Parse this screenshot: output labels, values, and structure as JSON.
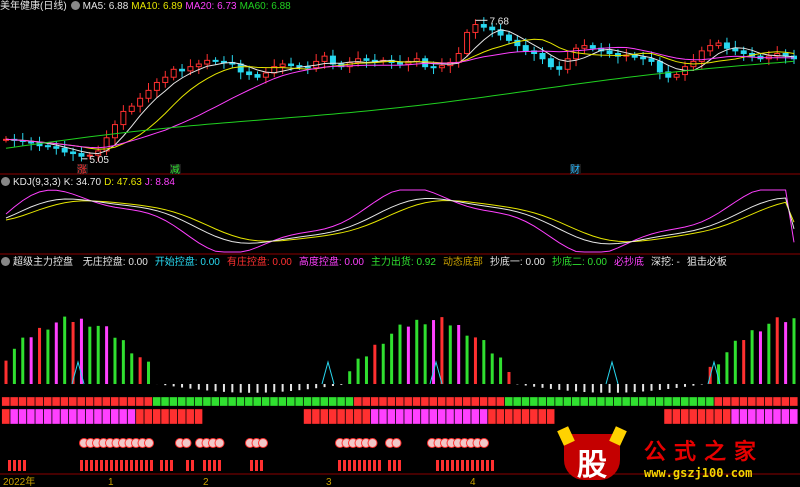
{
  "header_main": {
    "title": "美年健康(日线)",
    "ma5": "MA5: 6.88",
    "ma10": "MA10: 6.89",
    "ma20": "MA20: 6.73",
    "ma60": "MA60: 6.88"
  },
  "header_kdj": {
    "title": "KDJ(9,3,3)",
    "k": "K: 34.70",
    "d": "D: 47.63",
    "j": "J: 8.84"
  },
  "header_ind": {
    "title": "超级主力控盘",
    "items": [
      {
        "label": "无庄控盘: 0.00",
        "color": "#e6e6e6"
      },
      {
        "label": "开始控盘: 0.00",
        "color": "#28d8f0"
      },
      {
        "label": "有庄控盘: 0.00",
        "color": "#ff3030"
      },
      {
        "label": "高度控盘: 0.00",
        "color": "#ff40ff"
      },
      {
        "label": "主力出货: 0.92",
        "color": "#30e030"
      },
      {
        "label": "动态底部",
        "color": "#c8a000"
      },
      {
        "label": "抄底一: 0.00",
        "color": "#e6e6e6"
      },
      {
        "label": "抄底二: 0.00",
        "color": "#30e030"
      },
      {
        "label": "必抄底",
        "color": "#ff40ff"
      },
      {
        "label": "深挖: -",
        "color": "#e6e6e6"
      },
      {
        "label": "狙击必板",
        "color": "#e6e6e6"
      }
    ]
  },
  "annotations": {
    "high": "7.68",
    "low": "5.05",
    "markers": [
      {
        "text": "涨",
        "color": "#ff3030"
      },
      {
        "text": "减",
        "color": "#30e030"
      },
      {
        "text": "财",
        "color": "#28b8ff"
      }
    ]
  },
  "x_axis": {
    "labels": [
      "2022年",
      "1",
      "2",
      "3",
      "4"
    ]
  },
  "watermark": {
    "icon_text": "股",
    "name": "公式之家",
    "url": "www.gszj100.com"
  },
  "colors": {
    "up": "#ff3030",
    "down": "#28d8f0",
    "ma5": "#e6e6e6",
    "ma10": "#e6e600",
    "ma20": "#ff40ff",
    "ma60": "#20d020",
    "k": "#e6e6e6",
    "d": "#e6e600",
    "j": "#ff40ff"
  },
  "chart_data": [
    {
      "type": "candlestick",
      "title": "美年健康(日线)",
      "series": [
        {
          "name": "MA5",
          "value": 6.88
        },
        {
          "name": "MA10",
          "value": 6.89
        },
        {
          "name": "MA20",
          "value": 6.73
        },
        {
          "name": "MA60",
          "value": 6.88
        }
      ],
      "ylim": [
        4.8,
        7.8
      ],
      "high": 7.68,
      "low": 5.05,
      "close": [
        5.42,
        5.4,
        5.38,
        5.35,
        5.3,
        5.28,
        5.25,
        5.18,
        5.15,
        5.1,
        5.12,
        5.2,
        5.45,
        5.7,
        5.95,
        6.05,
        6.2,
        6.35,
        6.5,
        6.6,
        6.75,
        6.72,
        6.8,
        6.85,
        6.92,
        6.9,
        6.88,
        6.85,
        6.7,
        6.65,
        6.6,
        6.68,
        6.8,
        6.85,
        6.82,
        6.8,
        6.78,
        6.9,
        7.0,
        6.85,
        6.8,
        6.88,
        6.95,
        6.92,
        6.9,
        6.92,
        6.88,
        6.85,
        6.9,
        6.95,
        6.8,
        6.78,
        6.82,
        6.88,
        7.05,
        7.45,
        7.6,
        7.55,
        7.5,
        7.4,
        7.3,
        7.2,
        7.1,
        7.05,
        6.95,
        6.8,
        6.75,
        6.95,
        7.15,
        7.2,
        7.15,
        7.1,
        7.05,
        7.0,
        7.02,
        6.98,
        6.95,
        6.9,
        6.7,
        6.6,
        6.65,
        6.8,
        6.9,
        7.1,
        7.2,
        7.25,
        7.15,
        7.1,
        7.05,
        7.0,
        6.95,
        7.0,
        7.05,
        7.0,
        6.95
      ]
    },
    {
      "type": "line",
      "title": "KDJ(9,3,3)",
      "series": [
        {
          "name": "K",
          "last": 34.7
        },
        {
          "name": "D",
          "last": 47.63
        },
        {
          "name": "J",
          "last": 8.84
        }
      ],
      "ylim": [
        -10,
        110
      ]
    },
    {
      "type": "bar",
      "title": "超级主力控盘",
      "series": [
        {
          "name": "主力出货",
          "last": 0.92
        }
      ]
    }
  ]
}
